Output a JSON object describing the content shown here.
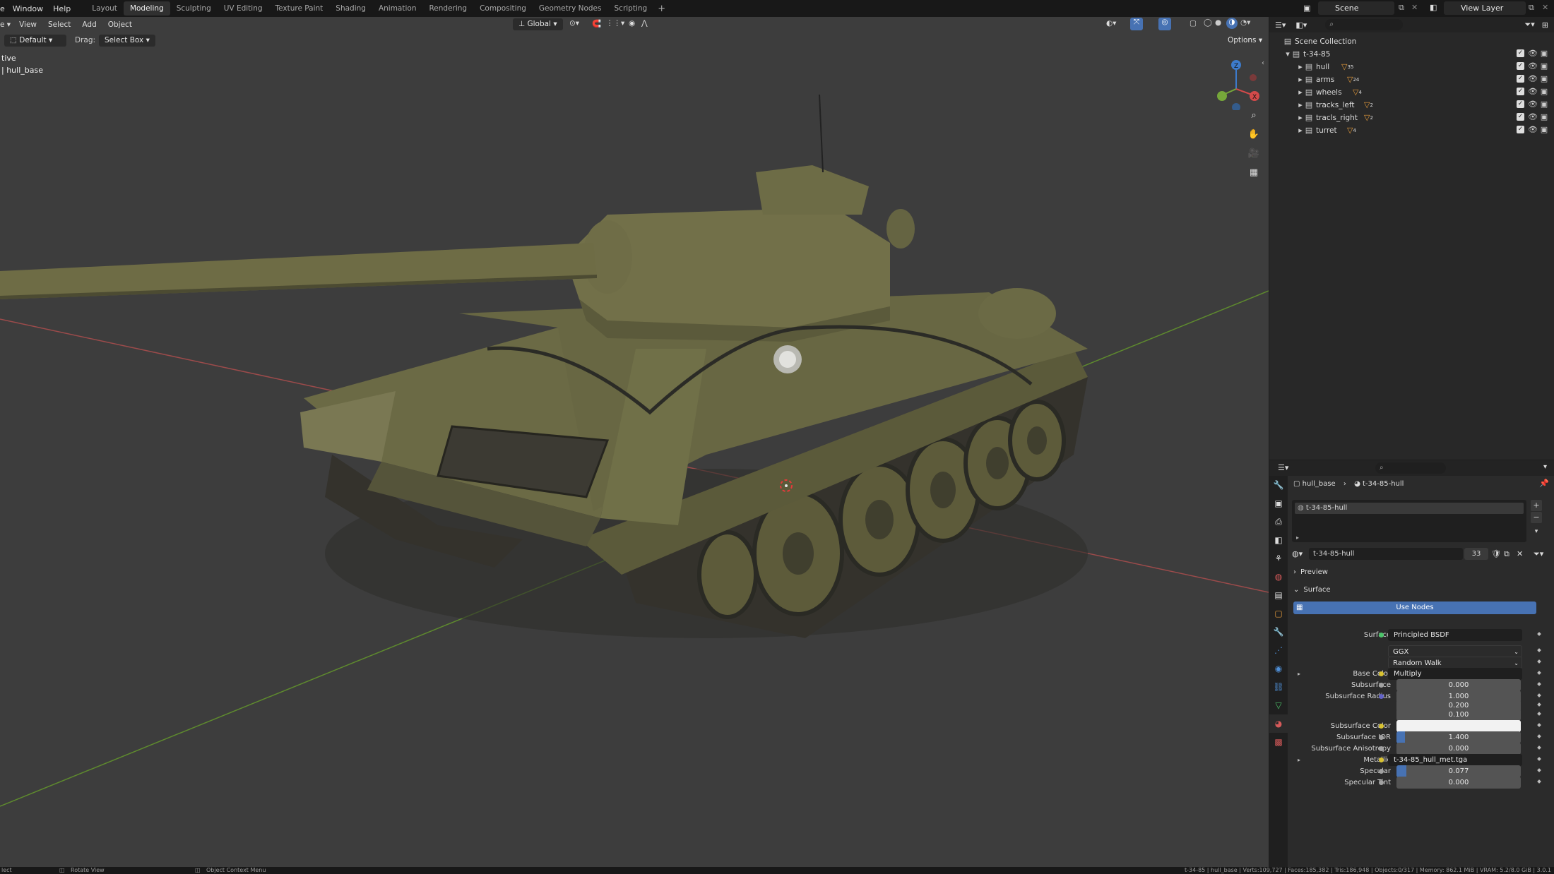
{
  "topbar": {
    "menus": [
      "Window",
      "Help"
    ],
    "tabs": [
      "Layout",
      "Modeling",
      "Sculpting",
      "UV Editing",
      "Texture Paint",
      "Shading",
      "Animation",
      "Rendering",
      "Compositing",
      "Geometry Nodes",
      "Scripting"
    ],
    "active_tab": "Modeling",
    "add_tab": "+",
    "scene": "Scene",
    "view_layer": "View Layer"
  },
  "viewport": {
    "header_menus": [
      "View",
      "Select",
      "Add",
      "Object"
    ],
    "transform_orientation": "Global",
    "tool_preset": "Default",
    "drag_label": "Drag:",
    "drag_value": "Select Box",
    "options_label": "Options",
    "overlay_line1": "tive",
    "overlay_line2": "| hull_base"
  },
  "outliner": {
    "root": "Scene Collection",
    "collection": "t-34-85",
    "objects": [
      {
        "name": "hull",
        "badge": "35"
      },
      {
        "name": "arms",
        "badge": "24"
      },
      {
        "name": "wheels",
        "badge": "4"
      },
      {
        "name": "tracks_left",
        "badge": "2"
      },
      {
        "name": "tracls_right",
        "badge": "2"
      },
      {
        "name": "turret",
        "badge": "4"
      }
    ]
  },
  "properties": {
    "breadcrumb_object": "hull_base",
    "breadcrumb_material": "t-34-85-hull",
    "slot_name": "t-34-85-hull",
    "material_name": "t-34-85-hull",
    "user_count": "33",
    "preview_label": "Preview",
    "surface_label": "Surface",
    "use_nodes_label": "Use Nodes",
    "rows": [
      {
        "label": "Surface",
        "value": "Principled BSDF",
        "kind": "link",
        "dot": "#4cc46a"
      },
      {
        "label": "",
        "value": "GGX",
        "kind": "dropdown"
      },
      {
        "label": "",
        "value": "Random Walk",
        "kind": "dropdown"
      },
      {
        "label": "Base Color",
        "value": "Multiply",
        "kind": "link",
        "dot": "#d8c231",
        "expand": true
      },
      {
        "label": "Subsurface",
        "value": "0.000",
        "kind": "num",
        "dot": "#a1a1a1"
      },
      {
        "label": "Subsurface Radius",
        "value": "1.000",
        "kind": "num",
        "dot": "#6363c7"
      },
      {
        "label": "",
        "value": "0.200",
        "kind": "num"
      },
      {
        "label": "",
        "value": "0.100",
        "kind": "num"
      },
      {
        "label": "Subsurface Color",
        "value": "",
        "kind": "color",
        "dot": "#d8c231"
      },
      {
        "label": "Subsurface IOR",
        "value": "1.400",
        "kind": "slider",
        "dot": "#a1a1a1",
        "fill": 0.07
      },
      {
        "label": "Subsurface Anisotropy",
        "value": "0.000",
        "kind": "num",
        "dot": "#a1a1a1"
      },
      {
        "label": "Metallic",
        "value": "t-34-85_hull_met.tga",
        "kind": "link",
        "dot": "#d8c231",
        "expand": true
      },
      {
        "label": "Specular",
        "value": "0.077",
        "kind": "slider",
        "dot": "#a1a1a1",
        "fill": 0.077
      },
      {
        "label": "Specular Tint",
        "value": "0.000",
        "kind": "num",
        "dot": "#a1a1a1"
      }
    ]
  },
  "statusbar": {
    "left1": "lect",
    "left2": "Rotate View",
    "left3": "Object Context Menu",
    "right": "t-34-85 | hull_base | Verts:109,727 | Faces:185,382 | Tris:186,948 | Objects:0/317 | Memory: 862.1 MiB | VRAM: 5.2/8.0 GiB | 3.0.1"
  },
  "colors": {
    "accent": "#4772b3",
    "axis_x": "#d34a4a",
    "axis_y": "#76a73a",
    "axis_z": "#3d7bcb"
  }
}
